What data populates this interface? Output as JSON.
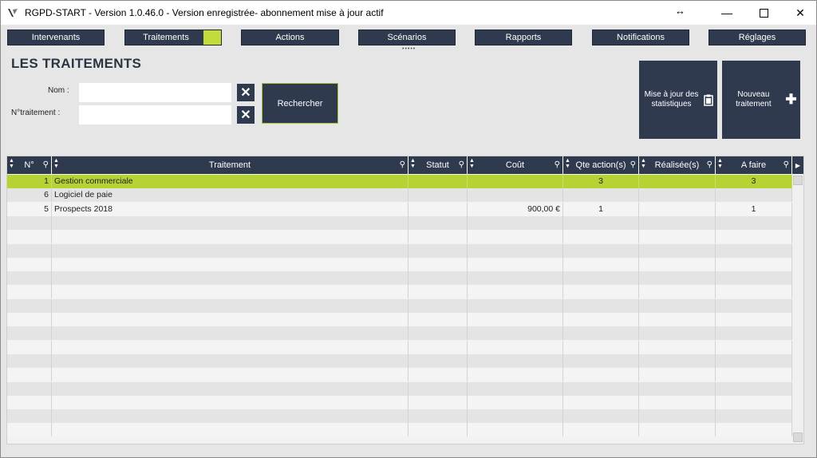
{
  "window": {
    "title": "RGPD-START - Version 1.0.46.0 -  Version enregistrée- abonnement mise à jour actif"
  },
  "nav": [
    {
      "label": "Intervenants"
    },
    {
      "label": "Traitements"
    },
    {
      "label": "Actions"
    },
    {
      "label": "Scénarios"
    },
    {
      "label": "Rapports"
    },
    {
      "label": "Notifications"
    },
    {
      "label": "Réglages"
    }
  ],
  "page": {
    "title": "LES TRAITEMENTS",
    "nom_label": "Nom :",
    "nom_value": "",
    "num_label": "N°traitement :",
    "num_value": "",
    "search_label": "Rechercher",
    "stats_label": "Mise à jour des statistiques",
    "new_label": "Nouveau traitement"
  },
  "table": {
    "columns": [
      "N°",
      "Traitement",
      "Statut",
      "Coût",
      "Qte action(s)",
      "Réalisée(s)",
      "A faire"
    ],
    "rows": [
      {
        "num": "1",
        "traitement": "Gestion commerciale",
        "statut": "",
        "cout": "",
        "qte": "3",
        "realisees": "",
        "afaire": "3"
      },
      {
        "num": "6",
        "traitement": "Logiciel de paie",
        "statut": "",
        "cout": "",
        "qte": "",
        "realisees": "",
        "afaire": ""
      },
      {
        "num": "5",
        "traitement": "Prospects 2018",
        "statut": "",
        "cout": "900,00 €",
        "qte": "1",
        "realisees": "",
        "afaire": "1"
      }
    ],
    "selected_row": 0
  },
  "colors": {
    "navy": "#2f3a4e",
    "accent": "#c3dc3b",
    "selected": "#b6d334"
  }
}
